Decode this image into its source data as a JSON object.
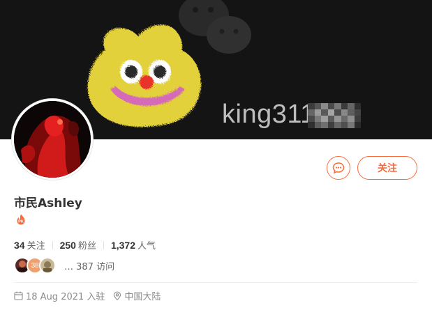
{
  "banner": {
    "watermark_text": "king311",
    "background_color": "#141414",
    "sticker_color": "#e3d13a",
    "icon": "wechat-logo-icon"
  },
  "profile": {
    "username": "市民Ashley",
    "badge_icon": "pk-flame-badge-icon",
    "avatar_icon": "red-silhouette-avatar"
  },
  "actions": {
    "message_icon": "chat-bubble-icon",
    "follow_label": "关注",
    "accent_color": "#f86b3c"
  },
  "stats": {
    "following_count": "34",
    "following_label": "关注",
    "followers_count": "250",
    "followers_label": "粉丝",
    "popularity_count": "1,372",
    "popularity_label": "人气"
  },
  "visitors": {
    "avatar_badge": "38",
    "visits_text": "… 387 访问"
  },
  "meta": {
    "join_date": "18 Aug 2021 入驻",
    "location": "中国大陆",
    "calendar_icon": "calendar-icon",
    "location_icon": "location-pin-icon"
  }
}
